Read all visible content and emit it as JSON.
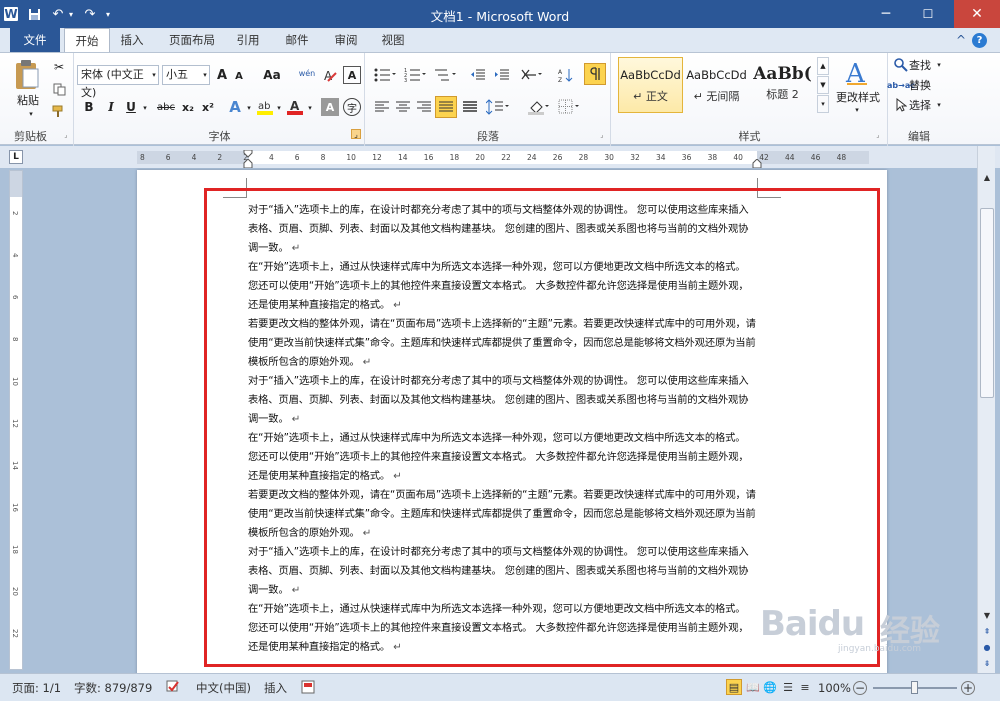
{
  "window": {
    "title": "文档1 - Microsoft Word",
    "minimize": "─",
    "maximize": "☐",
    "close": "✕"
  },
  "qat": {
    "logo": "W",
    "save": "💾",
    "undo": "↶",
    "redo": "↷",
    "more": "▾"
  },
  "tabs": [
    "文件",
    "开始",
    "插入",
    "页面布局",
    "引用",
    "邮件",
    "审阅",
    "视图"
  ],
  "tabbar_right": {
    "help": "?",
    "collapse": "^"
  },
  "ribbon": {
    "clipboard": {
      "paste": "粘贴",
      "label": "剪贴板"
    },
    "font": {
      "family": "宋体 (中文正文)",
      "size": "小五",
      "grow": "A",
      "shrink": "A",
      "case": "Aa",
      "wen": "wén",
      "bold": "B",
      "italic": "I",
      "underline": "U",
      "strike": "abc",
      "sub": "x₂",
      "sup": "x²",
      "label": "字体"
    },
    "paragraph": {
      "label": "段落"
    },
    "styles": {
      "items": [
        {
          "preview": "AaBbCcDd",
          "name": "↵ 正文"
        },
        {
          "preview": "AaBbCcDd",
          "name": "↵ 无间隔"
        },
        {
          "preview": "AaBb(",
          "name": "标题 2"
        }
      ],
      "change": "更改样式",
      "label": "样式"
    },
    "editing": {
      "find": "查找",
      "replace": "替换",
      "select": "选择",
      "label": "编辑"
    }
  },
  "ruler": {
    "marks": [
      "8",
      "6",
      "4",
      "2",
      "2",
      "4",
      "6",
      "8",
      "10",
      "12",
      "14",
      "16",
      "18",
      "20",
      "22",
      "24",
      "26",
      "28",
      "30",
      "32",
      "34",
      "36",
      "38",
      "40",
      "42",
      "44",
      "46",
      "48"
    ]
  },
  "document": {
    "paragraphs": [
      "对于“插入”选项卡上的库，在设计时都充分考虑了其中的项与文档整体外观的协调性。 您可以使用这些库来插入表格、页眉、页脚、列表、封面以及其他文档构建基块。 您创建的图片、图表或关系图也将与当前的文档外观协调一致。",
      "在“开始”选项卡上，通过从快速样式库中为所选文本选择一种外观，您可以方便地更改文档中所选文本的格式。 您还可以使用“开始”选项卡上的其他控件来直接设置文本格式。 大多数控件都允许您选择是使用当前主题外观，还是使用某种直接指定的格式。",
      "若要更改文档的整体外观，请在“页面布局”选项卡上选择新的“主题”元素。若要更改快速样式库中的可用外观，请使用“更改当前快速样式集”命令。主题库和快速样式库都提供了重置命令，因而您总是能够将文档外观还原为当前模板所包含的原始外观。",
      "对于“插入”选项卡上的库，在设计时都充分考虑了其中的项与文档整体外观的协调性。 您可以使用这些库来插入表格、页眉、页脚、列表、封面以及其他文档构建基块。 您创建的图片、图表或关系图也将与当前的文档外观协调一致。",
      "在“开始”选项卡上，通过从快速样式库中为所选文本选择一种外观，您可以方便地更改文档中所选文本的格式。 您还可以使用“开始”选项卡上的其他控件来直接设置文本格式。 大多数控件都允许您选择是使用当前主题外观，还是使用某种直接指定的格式。",
      "若要更改文档的整体外观，请在“页面布局”选项卡上选择新的“主题”元素。若要更改快速样式库中的可用外观，请使用“更改当前快速样式集”命令。主题库和快速样式库都提供了重置命令，因而您总是能够将文档外观还原为当前模板所包含的原始外观。",
      "对于“插入”选项卡上的库，在设计时都充分考虑了其中的项与文档整体外观的协调性。 您可以使用这些库来插入表格、页眉、页脚、列表、封面以及其他文档构建基块。 您创建的图片、图表或关系图也将与当前的文档外观协调一致。",
      "在“开始”选项卡上，通过从快速样式库中为所选文本选择一种外观，您可以方便地更改文档中所选文本的格式。 您还可以使用“开始”选项卡上的其他控件来直接设置文本格式。 大多数控件都允许您选择是使用当前主题外观，还是使用某种直接指定的格式。"
    ],
    "paragraph_mark": "↵"
  },
  "status": {
    "page": "页面: 1/1",
    "words": "字数: 879/879",
    "language": "中文(中国)",
    "mode": "插入",
    "zoom": "100%",
    "zoom_out": "−",
    "zoom_in": "+"
  },
  "watermark": {
    "brand": "Baidu",
    "cn": "经验",
    "sub": "jingyan.baidu.com"
  }
}
